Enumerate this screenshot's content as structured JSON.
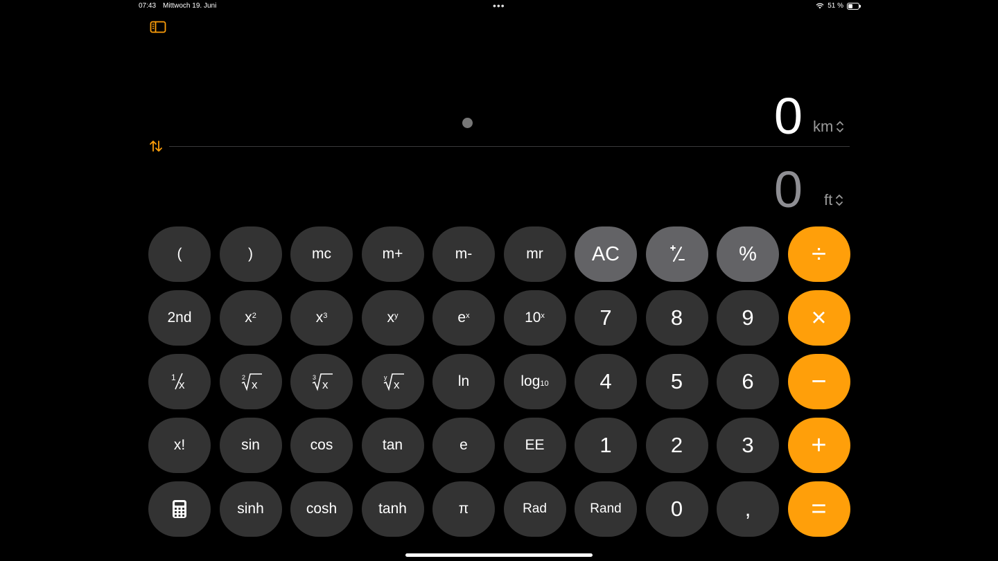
{
  "status": {
    "time": "07:43",
    "date": "Mittwoch 19. Juni",
    "more": "•••",
    "battery": "51 %"
  },
  "display": {
    "top_value": "0",
    "top_unit": "km",
    "bottom_value": "0",
    "bottom_unit": "ft"
  },
  "keys": {
    "open_paren": "(",
    "close_paren": ")",
    "mc": "mc",
    "m_plus": "m+",
    "m_minus": "m-",
    "mr": "mr",
    "ac": "AC",
    "percent": "%",
    "divide": "÷",
    "second": "2nd",
    "x": "x",
    "e": "e",
    "ten": "10",
    "seven": "7",
    "eight": "8",
    "nine": "9",
    "multiply": "×",
    "ln": "ln",
    "log": "log",
    "four": "4",
    "five": "5",
    "six": "6",
    "minus": "−",
    "factorial": "x!",
    "sin": "sin",
    "cos": "cos",
    "tan": "tan",
    "e_const": "e",
    "ee": "EE",
    "one": "1",
    "two": "2",
    "three": "3",
    "plus": "+",
    "sinh": "sinh",
    "cosh": "cosh",
    "tanh": "tanh",
    "pi": "π",
    "rad": "Rad",
    "rand": "Rand",
    "zero": "0",
    "comma": ",",
    "equals": "="
  }
}
